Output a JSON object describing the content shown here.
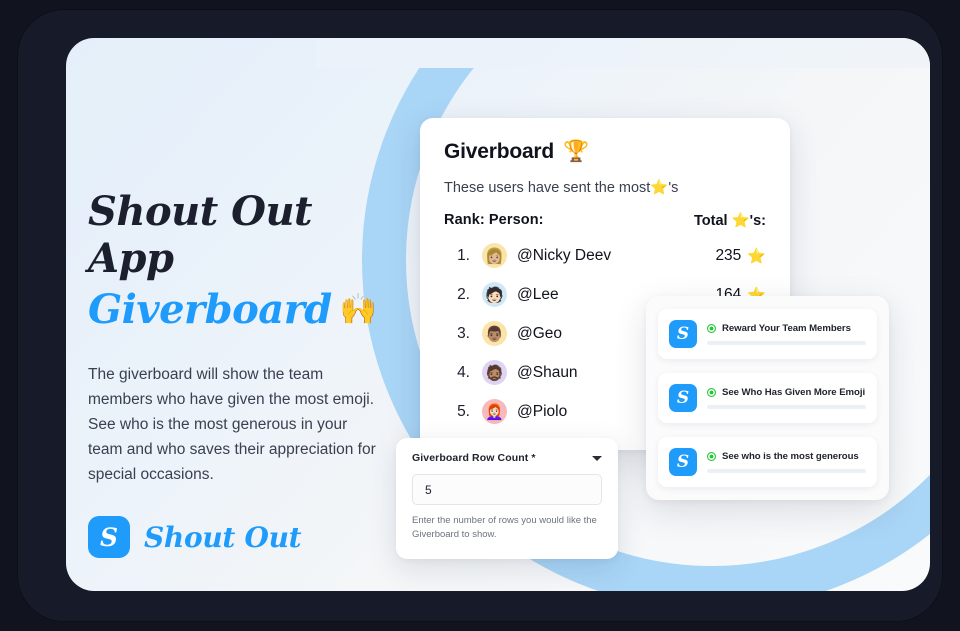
{
  "hero": {
    "headline_line1": "Shout Out App",
    "headline_line2": "Giverboard",
    "headline_emoji": "🙌",
    "body": "The giverboard will show the team members who have given the most emoji. See who is the most generous in your team and who saves their appreciation for special occasions.",
    "brand_badge_letter": "S",
    "brand_name": "Shout Out"
  },
  "giverboard": {
    "title": "Giverboard",
    "title_emoji": "🏆",
    "subtitle": "These users have sent the most⭐'s",
    "header_left": "Rank: Person:",
    "header_right": "Total ⭐'s:",
    "star_icon": "⭐",
    "rows": [
      {
        "rank": "1.",
        "name": "@Nicky Deev",
        "score": "235",
        "star": "⭐",
        "avatar_emoji": "👩🏼",
        "avatar_bg": "#fae4a8"
      },
      {
        "rank": "2.",
        "name": "@Lee",
        "score": "164",
        "star": "⭐",
        "avatar_emoji": "🧑🏻",
        "avatar_bg": "#cfe8f7"
      },
      {
        "rank": "3.",
        "name": "@Geo",
        "score": "",
        "star": "",
        "avatar_emoji": "👨🏽",
        "avatar_bg": "#fae4a8"
      },
      {
        "rank": "4.",
        "name": "@Shaun",
        "score": "",
        "star": "",
        "avatar_emoji": "🧔🏽",
        "avatar_bg": "#ded3f3"
      },
      {
        "rank": "5.",
        "name": "@Piolo",
        "score": "",
        "star": "",
        "avatar_emoji": "👩🏻‍🦰",
        "avatar_bg": "#f6b9bc"
      }
    ]
  },
  "form": {
    "label": "Giverboard Row Count *",
    "value": "5",
    "placeholder": "5",
    "helper": "Enter the number of rows you would like the Giverboard to show."
  },
  "notifications": {
    "badge_letter": "S",
    "items": [
      {
        "title": "Reward Your Team Members"
      },
      {
        "title": "See Who Has Given More Emoji"
      },
      {
        "title": "See who is the most generous"
      }
    ]
  },
  "colors": {
    "brand_blue": "#1e9bfb",
    "arc_blue": "#a9d5f6",
    "status_green": "#1fc82e",
    "frame_dark": "#171a28",
    "text_dark": "#10131c"
  }
}
